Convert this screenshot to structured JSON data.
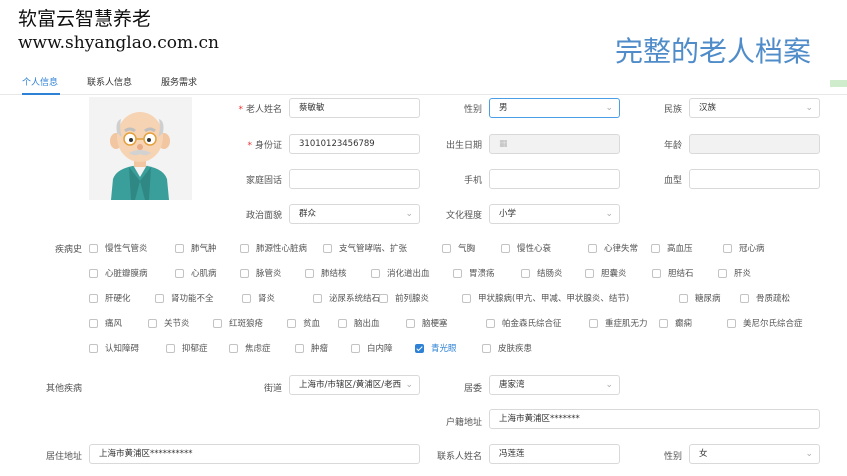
{
  "brand": {
    "name": "软富云智慧养老",
    "url": "www.shyanglao.com.cn",
    "page_title": "完整的老人档案"
  },
  "tabs": [
    {
      "label": "个人信息",
      "active": true
    },
    {
      "label": "联系人信息",
      "active": false
    },
    {
      "label": "服务需求",
      "active": false
    }
  ],
  "form": {
    "name_label": "老人姓名",
    "name_value": "蔡敏敏",
    "gender_label": "性别",
    "gender_value": "男",
    "ethnicity_label": "民族",
    "ethnicity_value": "汉族",
    "id_label": "身份证",
    "id_value": "31010123456789",
    "birth_label": "出生日期",
    "age_label": "年龄",
    "phone_label": "家庭固话",
    "mobile_label": "手机",
    "blood_label": "血型",
    "political_label": "政治面貌",
    "political_value": "群众",
    "education_label": "文化程度",
    "education_value": "小学",
    "disease_label": "疾病史",
    "other_disease_label": "其他疾病",
    "street_label": "街道",
    "street_value": "上海市/市辖区/黄浦区/老西",
    "committee_label": "居委",
    "committee_value": "唐家湾",
    "hukou_label": "户籍地址",
    "hukou_value": "上海市黄浦区*******",
    "residence_label": "居住地址",
    "residence_value": "上海市黄浦区**********",
    "contact_name_label": "联系人姓名",
    "contact_name_value": "冯莲莲",
    "contact_gender_label": "性别",
    "contact_gender_value": "女"
  },
  "diseases": [
    [
      "慢性气管炎",
      "肺气肿",
      "肺源性心脏病",
      "支气管哮喘、扩张",
      "气胸",
      "慢性心衰",
      "心律失常",
      "高血压",
      "冠心病"
    ],
    [
      "心脏瓣膜病",
      "心肌病",
      "脉管炎",
      "肺结核",
      "消化道出血",
      "胃溃疡",
      "结肠炎",
      "胆囊炎",
      "胆结石",
      "肝炎"
    ],
    [
      "肝硬化",
      "肾功能不全",
      "肾炎",
      "泌尿系统结石",
      "前列腺炎",
      "甲状腺病(甲亢、甲减、甲状腺炎、结节)",
      "糖尿病",
      "骨质疏松"
    ],
    [
      "痛风",
      "关节炎",
      "红斑狼疮",
      "贫血",
      "脑出血",
      "脑梗塞",
      "帕金森氏综合征",
      "重症肌无力",
      "癫痫",
      "美尼尔氏综合症"
    ],
    [
      "认知障碍",
      "抑郁症",
      "焦虑症",
      "肿瘤",
      "白内障",
      "青光眼",
      "皮肤疾患"
    ]
  ],
  "checked_diseases": [
    "青光眼"
  ],
  "icons": {
    "dropdown": "chevron-down-icon",
    "date": "calendar-icon",
    "avatar": "elderly-man-avatar"
  },
  "colors": {
    "accent": "#2e82d6",
    "title": "#4f8cc9",
    "required": "#e33333"
  }
}
